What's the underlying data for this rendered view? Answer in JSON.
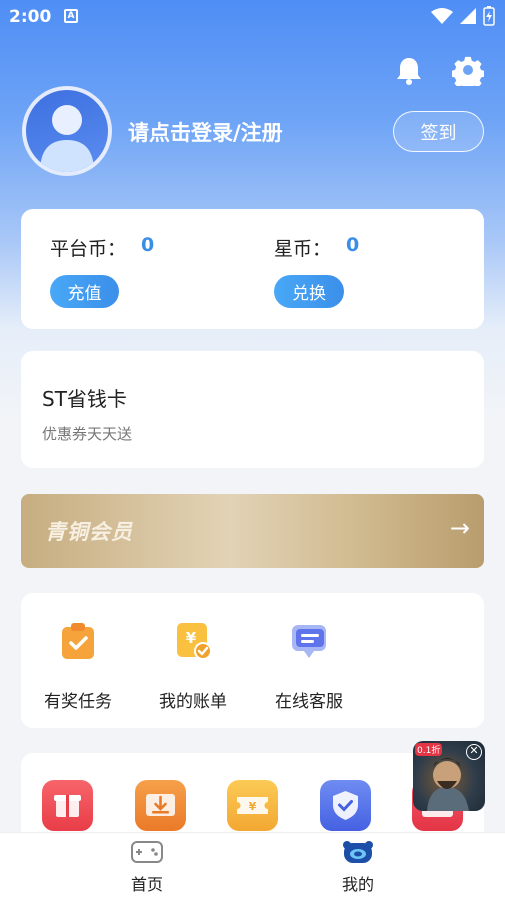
{
  "status_bar": {
    "time": "2:00",
    "a_icon": "A"
  },
  "header": {
    "login_text": "请点击登录/注册",
    "signin_label": "签到"
  },
  "coins": {
    "platform_label": "平台币：",
    "platform_value": "0",
    "platform_button": "充值",
    "star_label": "星币：",
    "star_value": "0",
    "star_button": "兑换"
  },
  "save_card": {
    "title": "ST省钱卡",
    "subtitle": "优惠券天天送"
  },
  "member": {
    "label": "青铜会员",
    "arrow": "→"
  },
  "grid": [
    {
      "label": "有奖任务",
      "icon": "task-clipboard-icon"
    },
    {
      "label": "我的账单",
      "icon": "bill-yen-icon"
    },
    {
      "label": "在线客服",
      "icon": "chat-service-icon"
    }
  ],
  "tools": [
    {
      "icon": "gift-icon",
      "color": "#f0484f"
    },
    {
      "icon": "download-ticket-icon",
      "color": "#f08a2c"
    },
    {
      "icon": "coupon-yen-icon",
      "color": "#f6b43a"
    },
    {
      "icon": "shield-check-icon",
      "color": "#4e6fe8"
    },
    {
      "icon": "envelope-icon",
      "color": "#ea4051"
    }
  ],
  "float_game": {
    "badge": "0.1折",
    "close": "✕"
  },
  "tabbar": [
    {
      "label": "首页",
      "icon": "gamepad-icon"
    },
    {
      "label": "我的",
      "icon": "profile-face-icon"
    }
  ],
  "colors": {
    "accent": "#3b8ee8",
    "header_blue": "#4f8ef5"
  }
}
